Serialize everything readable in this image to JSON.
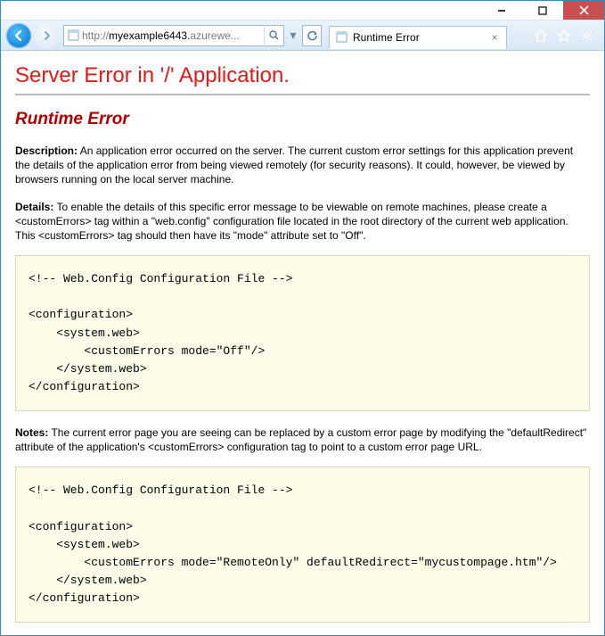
{
  "window": {
    "address_prefix": "http://",
    "address_host": "myexample6443.",
    "address_suffix": "azurewe...",
    "tab_title": "Runtime Error"
  },
  "page": {
    "h1": "Server Error in '/' Application.",
    "h2": "Runtime Error",
    "desc_label": "Description:",
    "desc_text": " An application error occurred on the server. The current custom error settings for this application prevent the details of the application error from being viewed remotely (for security reasons). It could, however, be viewed by browsers running on the local server machine.",
    "details_label": "Details:",
    "details_text": " To enable the details of this specific error message to be viewable on remote machines, please create a <customErrors> tag within a \"web.config\" configuration file located in the root directory of the current web application. This <customErrors> tag should then have its \"mode\" attribute set to \"Off\".",
    "code1": "<!-- Web.Config Configuration File -->\n\n<configuration>\n    <system.web>\n        <customErrors mode=\"Off\"/>\n    </system.web>\n</configuration>",
    "notes_label": "Notes:",
    "notes_text": " The current error page you are seeing can be replaced by a custom error page by modifying the \"defaultRedirect\" attribute of the application's <customErrors> configuration tag to point to a custom error page URL.",
    "code2": "<!-- Web.Config Configuration File -->\n\n<configuration>\n    <system.web>\n        <customErrors mode=\"RemoteOnly\" defaultRedirect=\"mycustompage.htm\"/>\n    </system.web>\n</configuration>"
  }
}
